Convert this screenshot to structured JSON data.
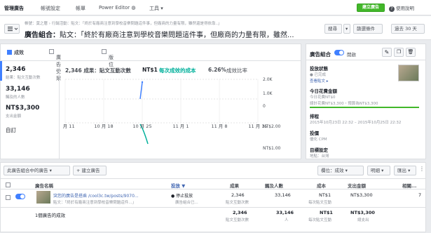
{
  "topbar": {
    "nav": [
      "管理廣告",
      "帳號設定",
      "帳單",
      "Power Editor ◍",
      "工具 ▾"
    ],
    "create_ad": "建立廣告",
    "help": "使用說明"
  },
  "header": {
    "breadcrumb": "帳號：莫之曆 › 行銷活動：貼文：「終於有廠商注意到學校音樂問題這件事，但廠商的力量有限，雖然還是得依靠..」",
    "title_prefix": "廣告組合：",
    "title_text": "貼文：「終於有廠商注意到學校音樂問題這件事，但廠商的力量有限，雖然...",
    "search": "搜尋",
    "filter": "篩選條件",
    "date_range": "過去 30 天"
  },
  "tabs": {
    "performance": "成效",
    "audience": "廣告受眾",
    "placement": "版位"
  },
  "summary": {
    "results_value": "2,346",
    "results_label": "結果：貼文互動次數",
    "reach_value": "33,146",
    "reach_label": "觸及的人數",
    "spent_value": "NT$3,300",
    "spent_label": "支出金額",
    "custom": "自訂"
  },
  "chart_header": {
    "results": "2,346 成果：貼文互動次數",
    "cost": "NT$1",
    "cost_label": "每次成效的成本",
    "rate": "6.26%",
    "rate_label": "成效比率"
  },
  "chart_data": {
    "type": "line",
    "x": [
      "10 月 11",
      "10 月 18",
      "10 月 25",
      "11 月 1",
      "11 月 8",
      "11 月 15"
    ],
    "series": [
      {
        "name": "成果：貼文互動次數",
        "color": "#4080ff",
        "values": [
          0,
          0,
          2346,
          0,
          0,
          0
        ]
      },
      {
        "name": "每次成效的成本",
        "color": "#00b09b",
        "values": [
          0,
          0,
          1,
          0,
          0,
          0
        ]
      }
    ],
    "y_right_ticks": [
      "2.0K",
      "1.0K",
      "0",
      "NT$2.00",
      "NT$1.00"
    ]
  },
  "adset_panel": {
    "title": "廣告組合",
    "status_on": "開啟",
    "delivery_label": "投放狀態",
    "delivery_value": "● 已完成",
    "delivery_sub": "查看貼文 ▸",
    "budget_label": "今日花費金額",
    "budget_line1": "今日花費NT$0",
    "budget_line2": "總計花費NT$3,300・預算為NT$3,300",
    "schedule_label": "排程",
    "schedule_value": "2015年10月23日 22:32 – 2015年10月25日 22:32",
    "bid_label": "投價",
    "bid_value": "優化 CPM",
    "audience_label": "目標設定",
    "audience_value": "地點：台灣"
  },
  "table_toolbar": {
    "adsets_dropdown": "此廣告組合中的廣告 ▾",
    "create_button": "+ 建立廣告",
    "columns": "欄位：成效 ▾",
    "breakdown": "明細 ▾",
    "export": "匯出 ▾"
  },
  "table": {
    "headers": [
      "廣告名稱",
      "投放 ▼",
      "成果",
      "觸及人數",
      "成本",
      "支出金額",
      "相關..."
    ],
    "row": {
      "name_link": "突您的廣告是搭乘 /cool3c.tw/posts/9070...",
      "name_sub": "貼文：「終於有廠商注意到學校音樂問題這件...」",
      "delivery": "● 停止投放",
      "delivery_sub": "廣告組合已...",
      "results": "2,346",
      "results_sub": "貼文互動次數",
      "reach": "33,146",
      "cost": "NT$1",
      "cost_sub": "每次貼文互動",
      "spent": "NT$3,300",
      "relevance": "7"
    },
    "total": {
      "label": "1個廣告的成效",
      "results": "2,346",
      "results_sub": "貼文互動次數",
      "reach": "33,146",
      "reach_sub": "人",
      "cost": "NT$1",
      "cost_sub": "每次貼文互動",
      "spent": "NT$3,300",
      "spent_sub": "總支出"
    }
  }
}
